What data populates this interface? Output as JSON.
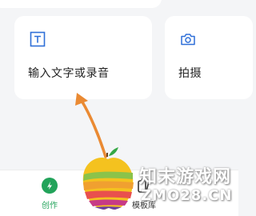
{
  "cards": {
    "text_input": {
      "label": "输入文字或录音",
      "icon": "text-icon"
    },
    "photo": {
      "label": "拍摄",
      "icon": "camera-icon"
    }
  },
  "bottom_nav": {
    "create": {
      "label": "创作",
      "icon": "create-icon",
      "active": true,
      "color": "#22a35a"
    },
    "template": {
      "label": "模板库",
      "icon": "template-icon",
      "active": false
    }
  },
  "watermark": {
    "text": "知末游戏网",
    "domain": "ZMO28.CN"
  },
  "annotation": {
    "arrow_color": "#ea8a33"
  }
}
